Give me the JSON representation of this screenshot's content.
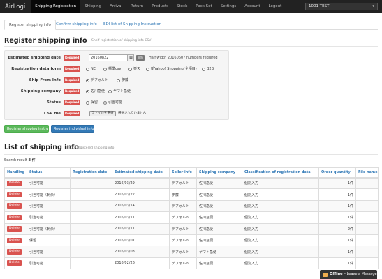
{
  "nav": {
    "brand": "AirLogi",
    "items": [
      "Shipping Registration",
      "Shipping",
      "Arrival",
      "Return",
      "Products",
      "Stock",
      "Pack Set",
      "Settings",
      "Account",
      "Logout"
    ],
    "account": "1001 TEST"
  },
  "tabs": [
    "Register shipping info",
    "Confirm shipping info",
    "EDI list of Shipping Instruction"
  ],
  "register": {
    "title": "Register shipping info",
    "subtitle": "Shelf registration of shipping info CSV",
    "required_label": "Required",
    "estimated_label": "Estimated shipping date",
    "estimated_value": "20160822",
    "calendar_icon": "calendar-icon",
    "half_width_badge": "半角",
    "estimated_hint": "Half-width 20160607 numbers required",
    "form_label": "Registration data form",
    "form_options": [
      "NE",
      "標準csv",
      "楽天",
      "新Yahoo! Shopping(全項目)",
      "B2B"
    ],
    "shipfrom_label": "Ship From Info",
    "shipfrom_options": [
      "デフォルト",
      "伊藤"
    ],
    "company_label": "Shipping company",
    "company_options": [
      "佐川急便",
      "ヤマト急便"
    ],
    "status_label": "Status",
    "status_options": [
      "保留",
      "引当可能"
    ],
    "csv_label": "CSV file",
    "file_button": "ファイルを選択",
    "file_text": "選択されていません",
    "btn_csv": "Register shipping instru",
    "btn_individual": "Register individual info"
  },
  "list": {
    "title": "List of shipping info",
    "subtitle": "List of registered shipping info",
    "result_label": "Search result",
    "result_count": "8 件",
    "headers": [
      "Handling",
      "Status",
      "Registration date",
      "Estimated shipping date",
      "Seller info",
      "Shipping company",
      "Classification of registration data",
      "Order quantity",
      "File name"
    ],
    "delete_label": "Delete",
    "rows": [
      {
        "status": "引当可能",
        "reg": "",
        "date": "2016/03/29",
        "seller": "デフォルト",
        "company": "佐川急便",
        "cls": "個別入力",
        "qty": "1件",
        "file": ""
      },
      {
        "status": "引当可能（剰余）",
        "reg": "",
        "date": "2016/03/22",
        "seller": "伊藤",
        "company": "佐川急便",
        "cls": "個別入力",
        "qty": "1件",
        "file": ""
      },
      {
        "status": "引当可能",
        "reg": "",
        "date": "2016/03/14",
        "seller": "デフォルト",
        "company": "佐川急便",
        "cls": "個別入力",
        "qty": "1件",
        "file": ""
      },
      {
        "status": "引当可能",
        "reg": "",
        "date": "2016/03/11",
        "seller": "デフォルト",
        "company": "佐川急便",
        "cls": "個別入力",
        "qty": "1件",
        "file": ""
      },
      {
        "status": "引当可能（剰余）",
        "reg": "",
        "date": "2016/03/11",
        "seller": "デフォルト",
        "company": "佐川急便",
        "cls": "個別入力",
        "qty": "2件",
        "file": ""
      },
      {
        "status": "保留",
        "reg": "",
        "date": "2016/03/07",
        "seller": "デフォルト",
        "company": "佐川急便",
        "cls": "個別入力",
        "qty": "1件",
        "file": ""
      },
      {
        "status": "引当可能",
        "reg": "",
        "date": "2016/03/03",
        "seller": "デフォルト",
        "company": "ヤマト急便",
        "cls": "個別入力",
        "qty": "1件",
        "file": ""
      },
      {
        "status": "引当可能",
        "reg": "",
        "date": "2016/02/26",
        "seller": "デフォルト",
        "company": "佐川急便",
        "cls": "個別入力",
        "qty": "1件",
        "file": ""
      }
    ]
  },
  "chat": {
    "status": "Offline",
    "text": "– Leave a Message"
  },
  "colors": {
    "nav_bg": "#222222",
    "link": "#337ab7",
    "danger": "#d9534f",
    "success": "#5cb85c",
    "primary": "#337ab7"
  }
}
